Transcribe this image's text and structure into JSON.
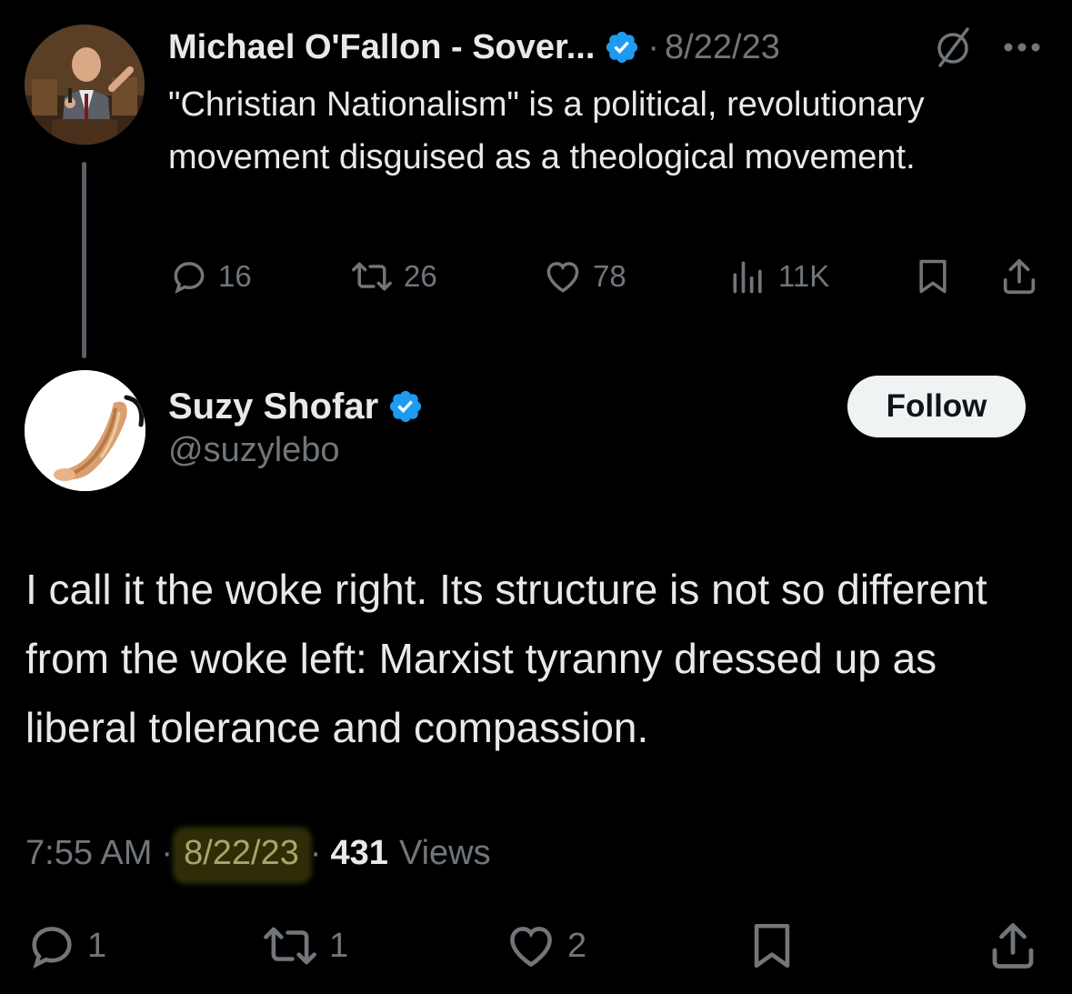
{
  "parent_tweet": {
    "author_name": "Michael O'Fallon - Sover...",
    "separator": "·",
    "date": "8/22/23",
    "text": "\"Christian Nationalism\" is a political, revolutionary movement disguised as a theological movement.",
    "actions": {
      "replies": "16",
      "reposts": "26",
      "likes": "78",
      "views": "11K"
    },
    "icons": [
      "verified-badge-icon",
      "no-edit-icon",
      "more-icon",
      "reply-icon",
      "repost-icon",
      "like-icon",
      "views-icon",
      "bookmark-icon",
      "share-icon"
    ]
  },
  "main_tweet": {
    "author_name": "Suzy Shofar",
    "handle": "@suzylebo",
    "follow_label": "Follow",
    "text": "I call it the woke right. Its structure is not so different from the woke left: Marxist tyranny dressed up as liberal tolerance and compassion.",
    "time": "7:55 AM",
    "separator": "·",
    "date": "8/22/23",
    "views_count": "431",
    "views_label": "Views",
    "actions": {
      "replies": "1",
      "reposts": "1",
      "likes": "2"
    }
  },
  "colors": {
    "background": "#000000",
    "primary_text": "#e7e9ea",
    "secondary_text": "#71767b",
    "verified_blue": "#1d9bf0",
    "thread_line": "#5b6066",
    "date_highlight": "#6b6a18"
  }
}
